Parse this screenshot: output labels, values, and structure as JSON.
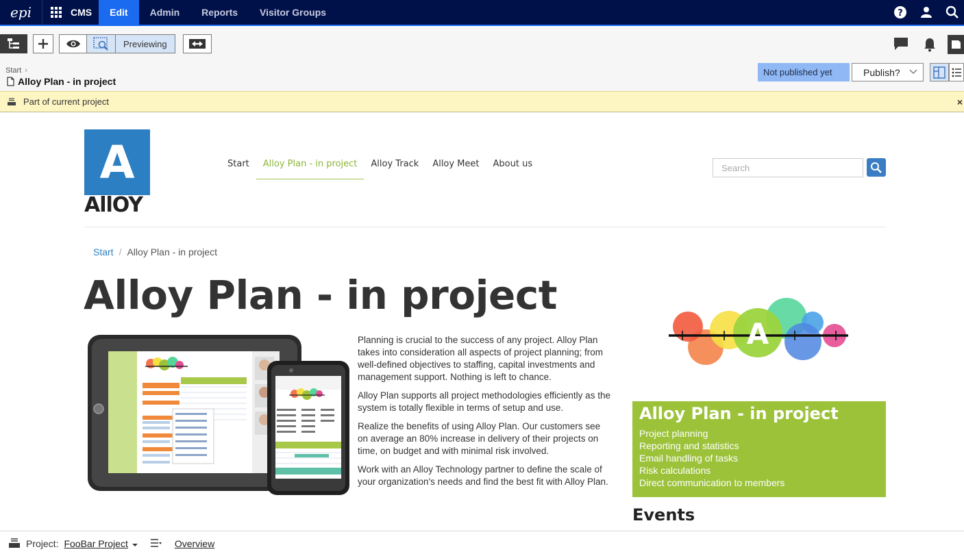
{
  "topnav": {
    "logo": "epi",
    "product": "CMS",
    "tabs": [
      {
        "label": "Edit",
        "active": true
      },
      {
        "label": "Admin",
        "active": false
      },
      {
        "label": "Reports",
        "active": false
      },
      {
        "label": "Visitor Groups",
        "active": false
      }
    ],
    "icons": [
      "help-icon",
      "user-icon",
      "search-icon"
    ]
  },
  "toolbar": {
    "previewing_label": "Previewing",
    "icons": [
      "page-tree-icon",
      "add-icon",
      "eye-icon",
      "preview-icon",
      "compare-icon",
      "comments-icon",
      "notifications-icon",
      "assets-panel-icon"
    ]
  },
  "breadcrumb": {
    "root": "Start",
    "page_title": "Alloy Plan - in project"
  },
  "status": {
    "badge": "Not published yet",
    "publish_label": "Publish?"
  },
  "project_notice": {
    "text": "Part of current project",
    "close": "×"
  },
  "site": {
    "logo_letter": "A",
    "logo_word": "AllOY",
    "menu": [
      {
        "label": "Start",
        "active": false
      },
      {
        "label": "Alloy Plan - in project",
        "active": true
      },
      {
        "label": "Alloy Track",
        "active": false
      },
      {
        "label": "Alloy Meet",
        "active": false
      },
      {
        "label": "About us",
        "active": false
      }
    ],
    "search_placeholder": "Search",
    "crumb": {
      "root": "Start",
      "sep": "/",
      "current": "Alloy Plan - in project"
    },
    "heading": "Alloy Plan - in project",
    "paragraphs": [
      "Planning is crucial to the success of any project. Alloy Plan takes into consideration all aspects of project planning; from well-defined objectives to staffing, capital investments and management support. Nothing is left to chance.",
      "Alloy Plan supports all project methodologies efficiently as the system is totally flexible in terms of setup and use.",
      "Realize the benefits of using Alloy Plan. Our customers see on average an 80% increase in delivery of their projects on time, on budget and with minimal risk involved.",
      "Work with an Alloy Technology partner to define the scale of your organization's needs and find the best fit with Alloy Plan."
    ],
    "card": {
      "title": "Alloy Plan - in project",
      "items": [
        "Project planning",
        "Reporting and statistics",
        "Email handling of tasks",
        "Risk calculations",
        "Direct communication to members"
      ]
    },
    "events_heading": "Events",
    "accent": "#9cc23a",
    "brand_blue": "#2b7fc2"
  },
  "bottombar": {
    "project_label": "Project:",
    "project_name": "FooBar Project",
    "overview": "Overview"
  }
}
